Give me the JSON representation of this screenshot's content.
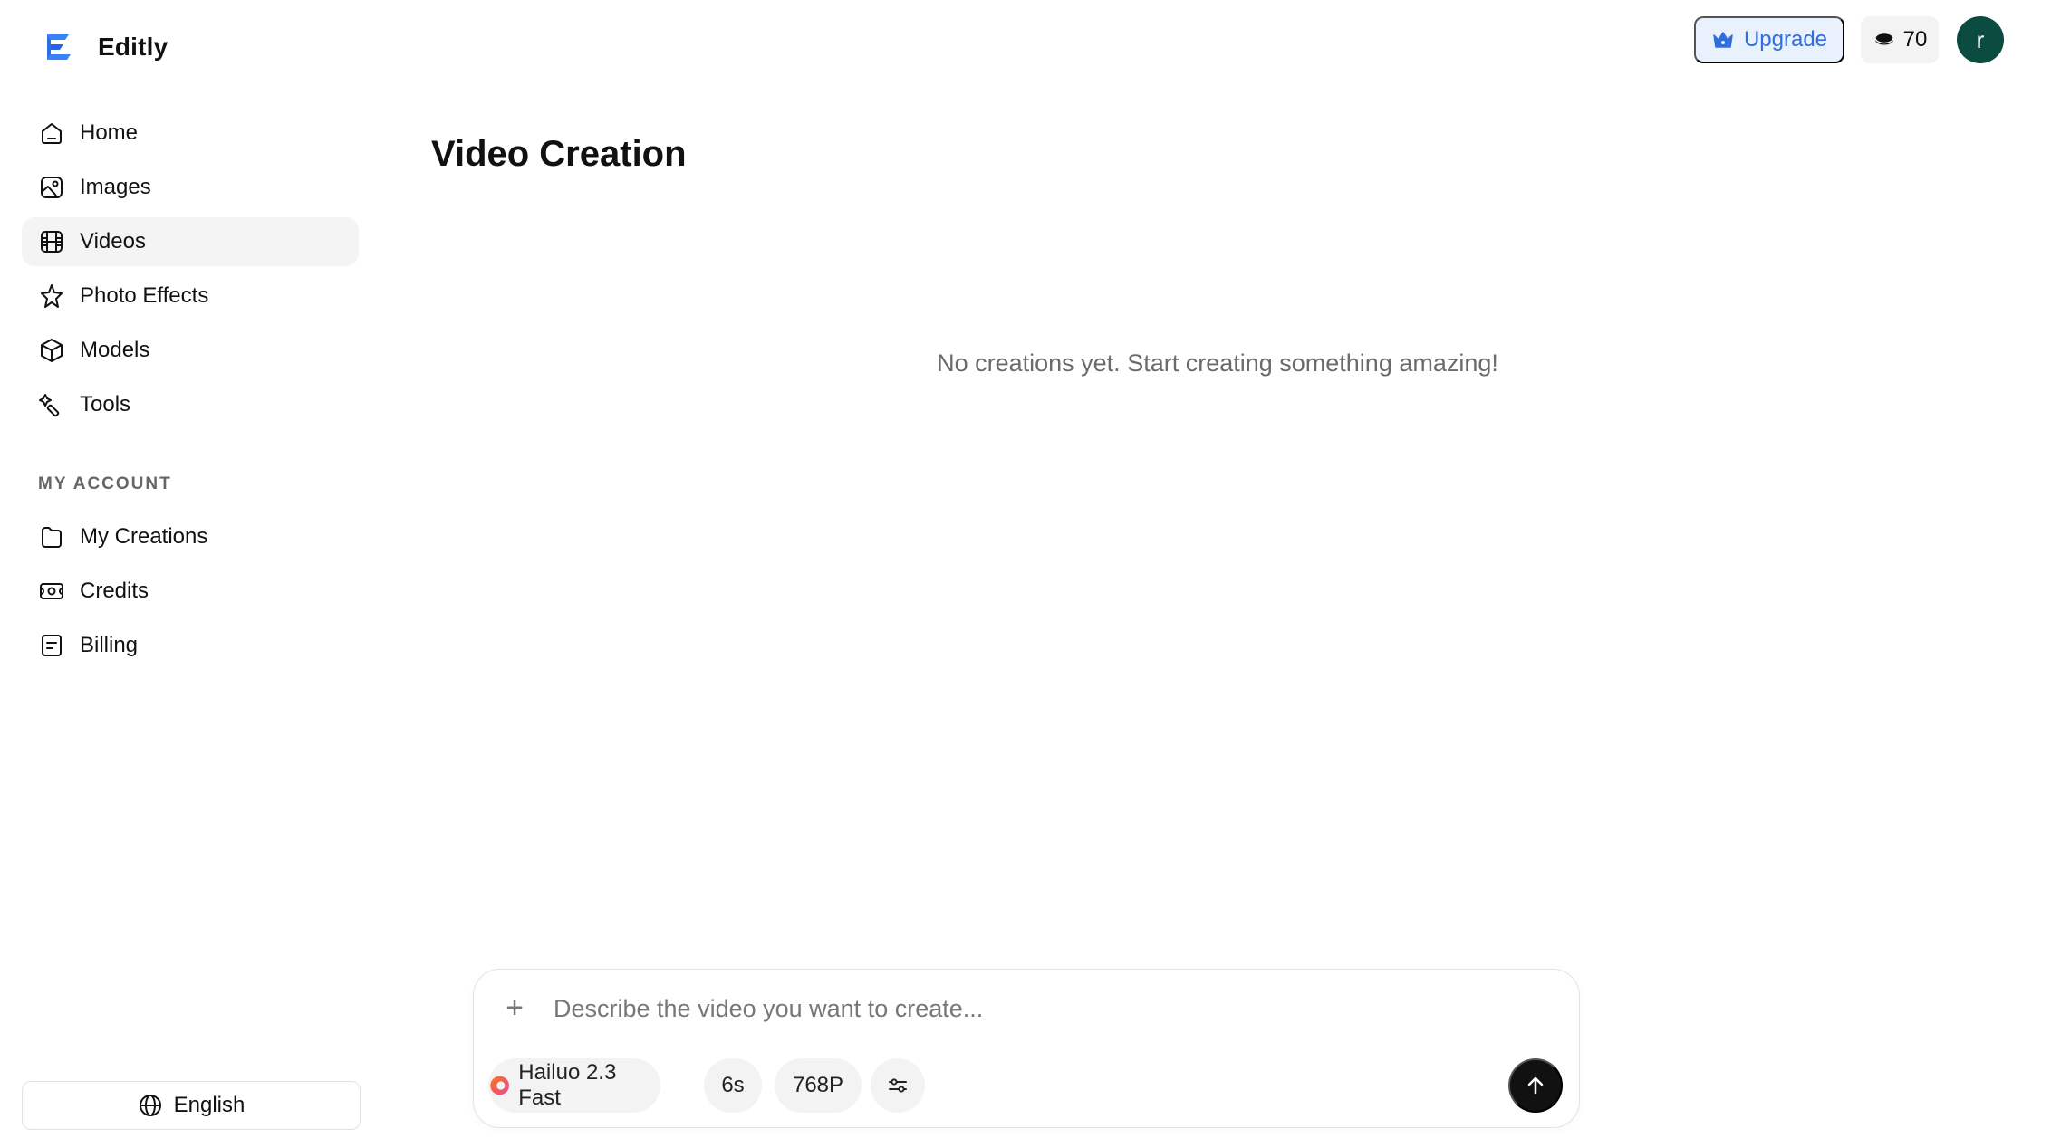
{
  "app": {
    "name": "Editly"
  },
  "sidebar": {
    "items": [
      {
        "label": "Home",
        "icon": "home-icon",
        "active": false
      },
      {
        "label": "Images",
        "icon": "image-icon",
        "active": false
      },
      {
        "label": "Videos",
        "icon": "film-icon",
        "active": true
      },
      {
        "label": "Photo Effects",
        "icon": "sparkle-star-icon",
        "active": false
      },
      {
        "label": "Models",
        "icon": "cube-icon",
        "active": false
      },
      {
        "label": "Tools",
        "icon": "magic-wand-icon",
        "active": false
      }
    ],
    "account_label": "MY ACCOUNT",
    "account_items": [
      {
        "label": "My Creations",
        "icon": "folder-icon"
      },
      {
        "label": "Credits",
        "icon": "ticket-icon"
      },
      {
        "label": "Billing",
        "icon": "receipt-icon"
      }
    ],
    "language": "English"
  },
  "header": {
    "upgrade_label": "Upgrade",
    "credits": "70",
    "avatar_initial": "r"
  },
  "main": {
    "title": "Video Creation",
    "empty_message": "No creations yet. Start creating something amazing!"
  },
  "composer": {
    "placeholder": "Describe the video you want to create...",
    "model": "Hailuo 2.3 Fast",
    "duration": "6s",
    "resolution": "768P"
  },
  "colors": {
    "accent_blue": "#2f6ede",
    "upgrade_bg": "#e9f1fd",
    "avatar_bg": "#0c4b3f",
    "active_nav_bg": "#f4f4f5",
    "send_bg": "#111111"
  }
}
